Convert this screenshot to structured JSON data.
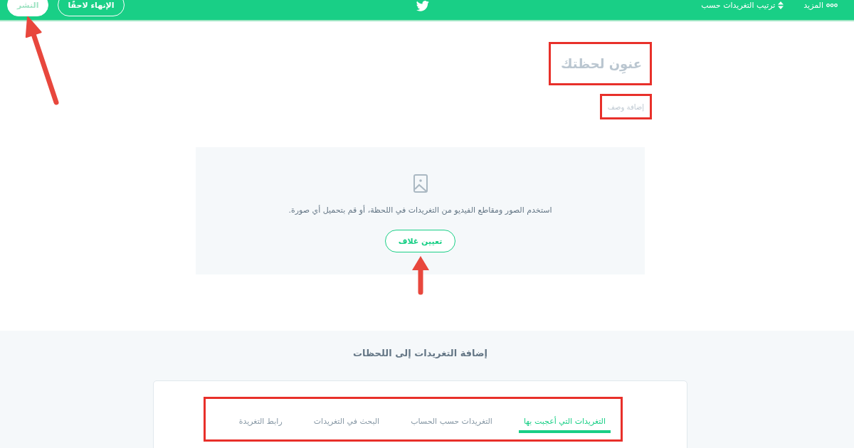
{
  "top_bar": {
    "menu": [
      {
        "kind": "more",
        "label": "المزيد"
      },
      {
        "kind": "sort",
        "label": "ترتيب التغريدات حسب"
      }
    ],
    "buttons": [
      {
        "kind": "outline",
        "label": "الإنهاء لاحقًا",
        "pointed_at": false
      },
      {
        "kind": "filled",
        "label": "النشر",
        "pointed_at": true
      }
    ]
  },
  "moment": {
    "title": {
      "placeholder": "عنوِن لحظتك",
      "highlighted": true
    },
    "description": {
      "placeholder": "إضافة وصف",
      "highlighted": true
    }
  },
  "cover": {
    "text": "استخدم الصور ومقاطع الفيديو من التغريدات في اللحظة، أو قم بتحميل أي صورة.",
    "button": {
      "label": "تعيين غلاف",
      "pointed_at": true
    }
  },
  "tweets_section": {
    "heading": "إضافة التغريدات إلى اللحظات",
    "tabs_highlighted": true,
    "tabs": [
      {
        "label": "التغريدات التي أعجبت بها",
        "selected": true
      },
      {
        "label": "التغريدات حسب الحساب",
        "selected": false
      },
      {
        "label": "البحث في التغريدات",
        "selected": false
      },
      {
        "label": "رابط التغريدة",
        "selected": false
      }
    ]
  }
}
